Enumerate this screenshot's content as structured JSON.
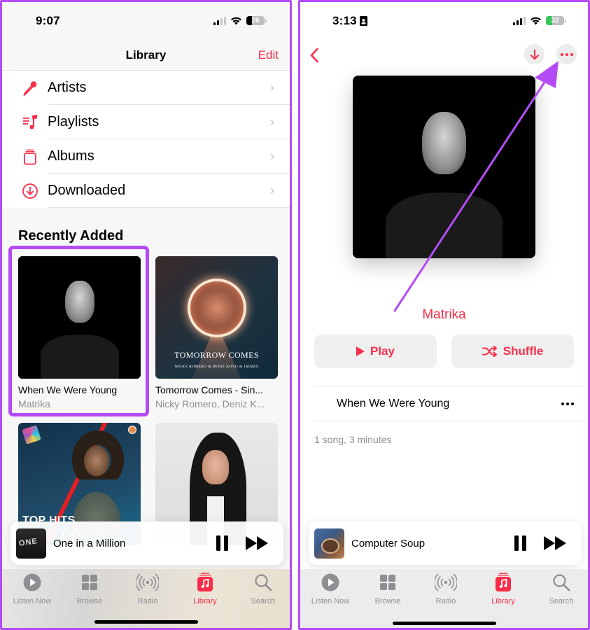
{
  "theme": {
    "accent": "#fa2d48",
    "annotation": "#b44cf5"
  },
  "left": {
    "status": {
      "time": "9:07",
      "battery": "26",
      "battery_level": 0.26
    },
    "header": {
      "title": "Library",
      "edit": "Edit"
    },
    "library_items": [
      {
        "label": "Artists",
        "icon": "microphone-icon"
      },
      {
        "label": "Playlists",
        "icon": "playlist-icon"
      },
      {
        "label": "Albums",
        "icon": "album-stack-icon"
      },
      {
        "label": "Downloaded",
        "icon": "download-circle-icon"
      }
    ],
    "recently_added": {
      "title": "Recently Added",
      "albums": [
        {
          "title": "When We Were Young",
          "artist": "Matrika",
          "highlighted": true
        },
        {
          "title": "Tomorrow Comes - Sin...",
          "artist": "Nicky Romero, Deniz K...",
          "art_title": "TOMORROW COMES",
          "art_subtitle": "NICKY ROMERO & DENIZ KOYU & JAIMES"
        },
        {
          "title": "",
          "artist": "",
          "art_title": "TOP HITS",
          "art_subtitle": "Of"
        },
        {
          "title": "",
          "artist": ""
        }
      ]
    },
    "mini_player": {
      "title": "One in a Million"
    }
  },
  "right": {
    "status": {
      "time": "3:13",
      "battery": "32",
      "battery_level": 0.32,
      "charging": true
    },
    "album": {
      "artist": "Matrika",
      "play": "Play",
      "shuffle": "Shuffle",
      "tracks": [
        {
          "title": "When We Were Young"
        }
      ],
      "meta": "1 song, 3 minutes"
    },
    "mini_player": {
      "title": "Computer Soup"
    }
  },
  "tabbar": [
    {
      "label": "Listen Now",
      "icon": "play-circle-icon"
    },
    {
      "label": "Browse",
      "icon": "grid-icon"
    },
    {
      "label": "Radio",
      "icon": "radio-waves-icon"
    },
    {
      "label": "Library",
      "icon": "library-icon",
      "active": true
    },
    {
      "label": "Search",
      "icon": "search-icon"
    }
  ]
}
